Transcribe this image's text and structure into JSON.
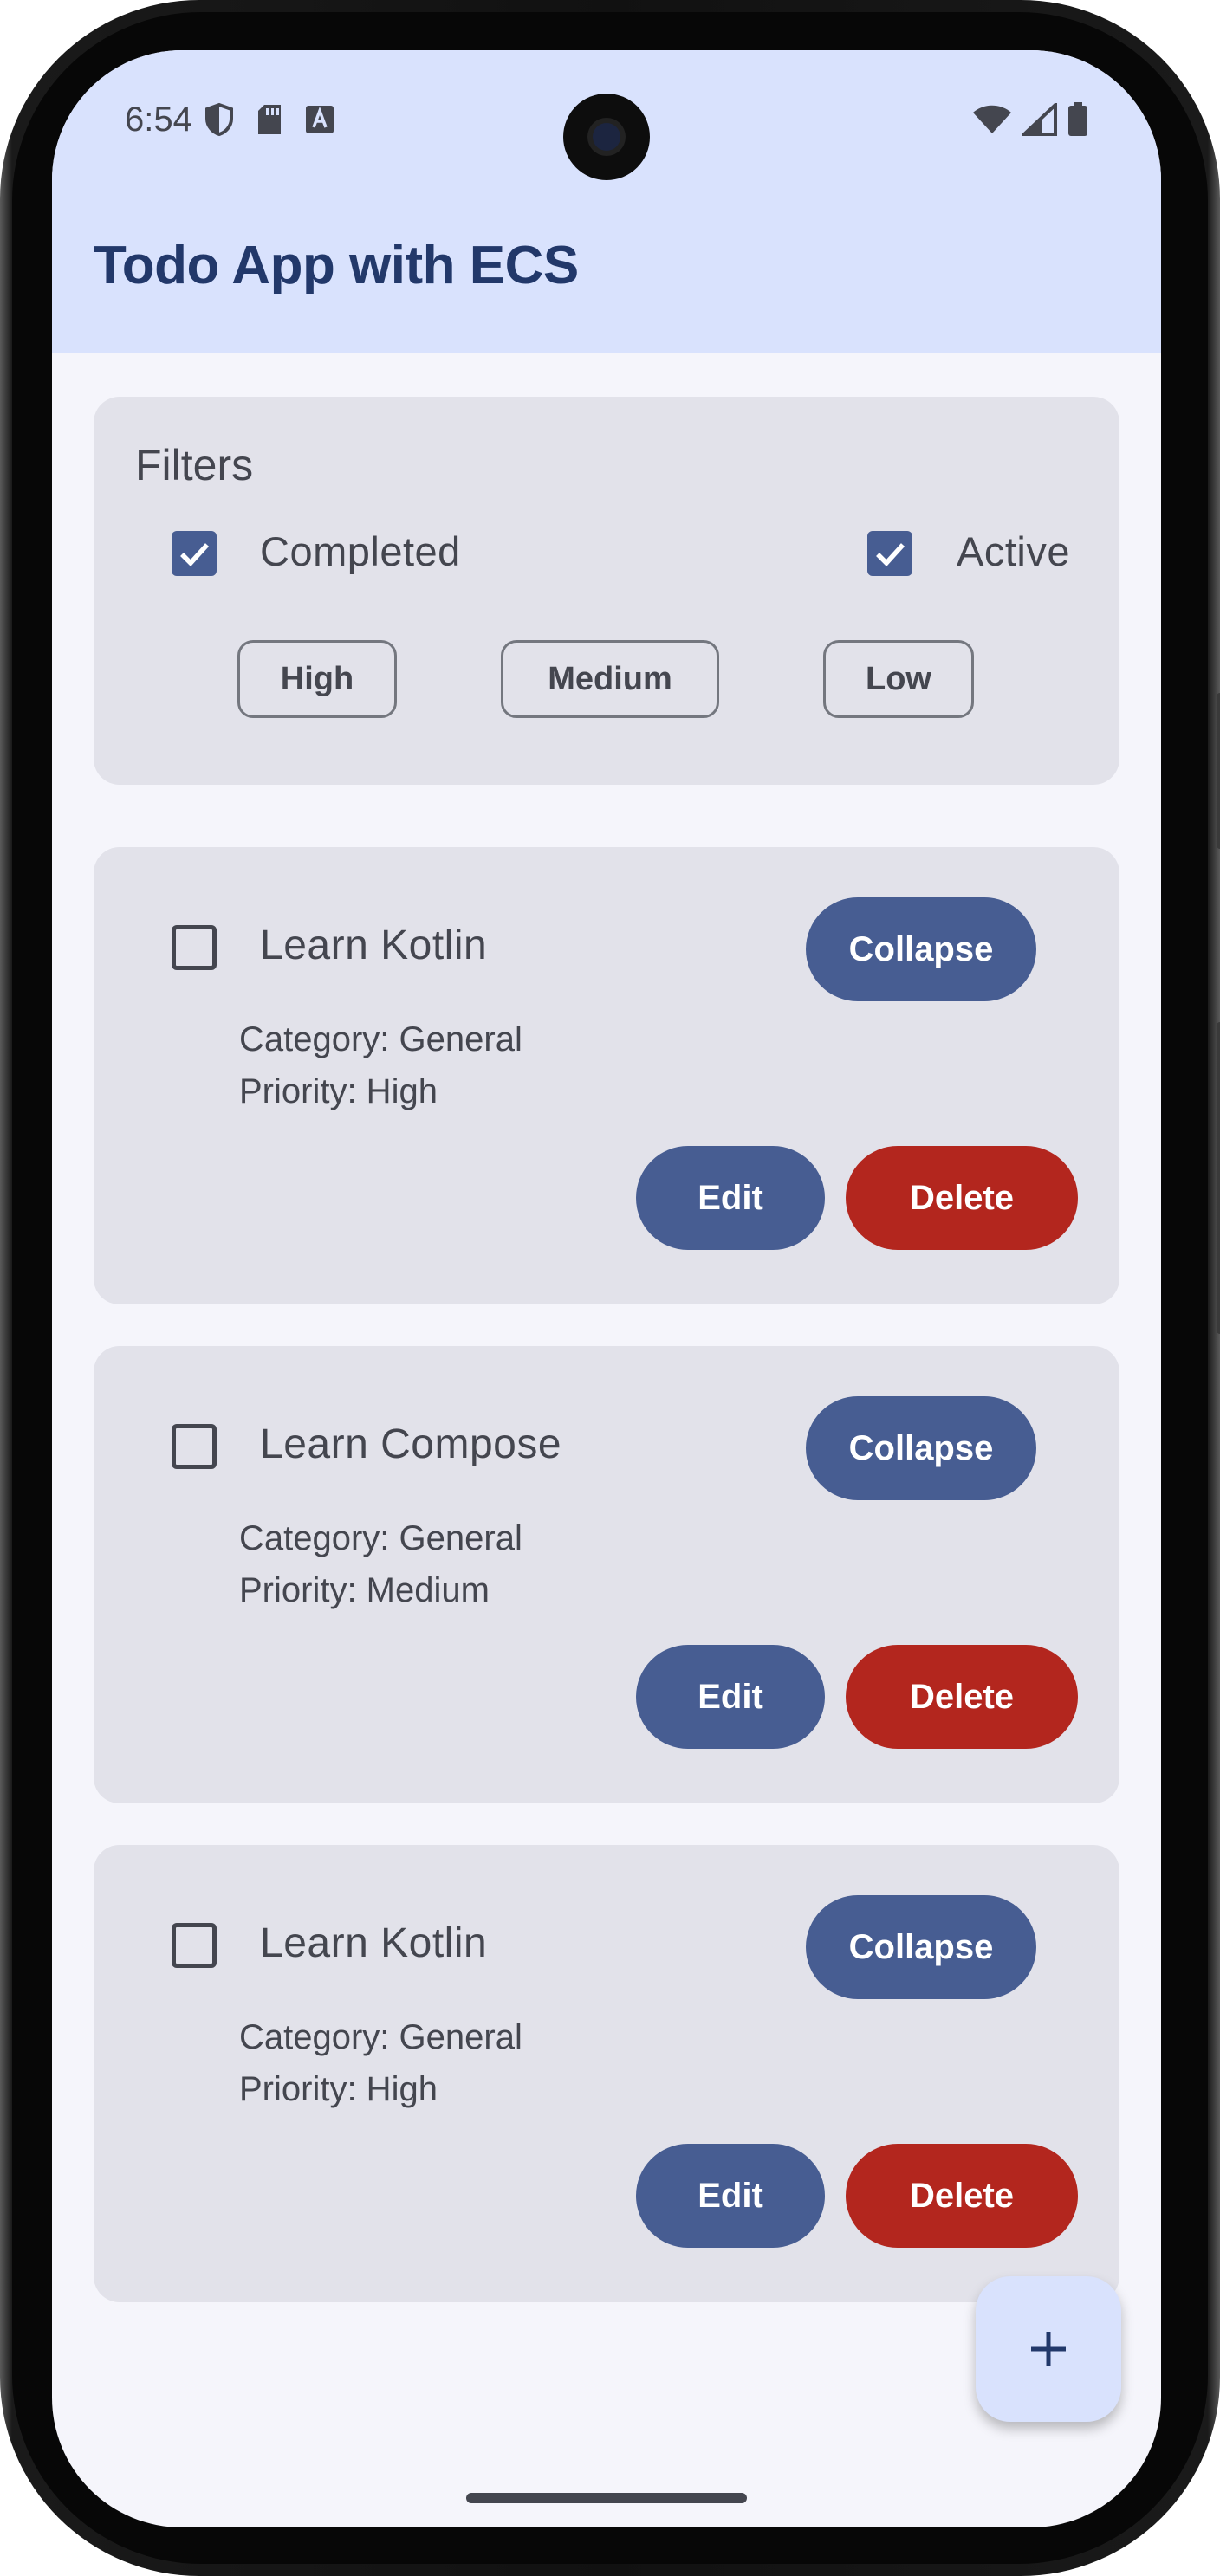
{
  "status_bar": {
    "time": "6:54",
    "left_icons": [
      "shield-icon",
      "sd-card-icon",
      "font-a-icon"
    ],
    "right_icons": [
      "wifi-icon",
      "signal-icon",
      "battery-icon"
    ]
  },
  "app_bar": {
    "title": "Todo App with ECS"
  },
  "filters": {
    "title": "Filters",
    "completed": {
      "label": "Completed",
      "checked": true
    },
    "active": {
      "label": "Active",
      "checked": true
    },
    "priority_chips": [
      "High",
      "Medium",
      "Low"
    ]
  },
  "todos": [
    {
      "title": "Learn Kotlin",
      "checked": false,
      "category": "Category: General",
      "priority": "Priority: High",
      "collapse_label": "Collapse",
      "edit_label": "Edit",
      "delete_label": "Delete"
    },
    {
      "title": "Learn Compose",
      "checked": false,
      "category": "Category: General",
      "priority": "Priority: Medium",
      "collapse_label": "Collapse",
      "edit_label": "Edit",
      "delete_label": "Delete"
    },
    {
      "title": "Learn Kotlin",
      "checked": false,
      "category": "Category: General",
      "priority": "Priority: High",
      "collapse_label": "Collapse",
      "edit_label": "Edit",
      "delete_label": "Delete"
    }
  ],
  "fab": {
    "icon": "plus-icon"
  },
  "colors": {
    "primary": "#475d92",
    "danger": "#b3261e",
    "app_bar_bg": "#d9e2fd",
    "card_bg": "#e2e2ea",
    "title_text": "#22386a"
  }
}
